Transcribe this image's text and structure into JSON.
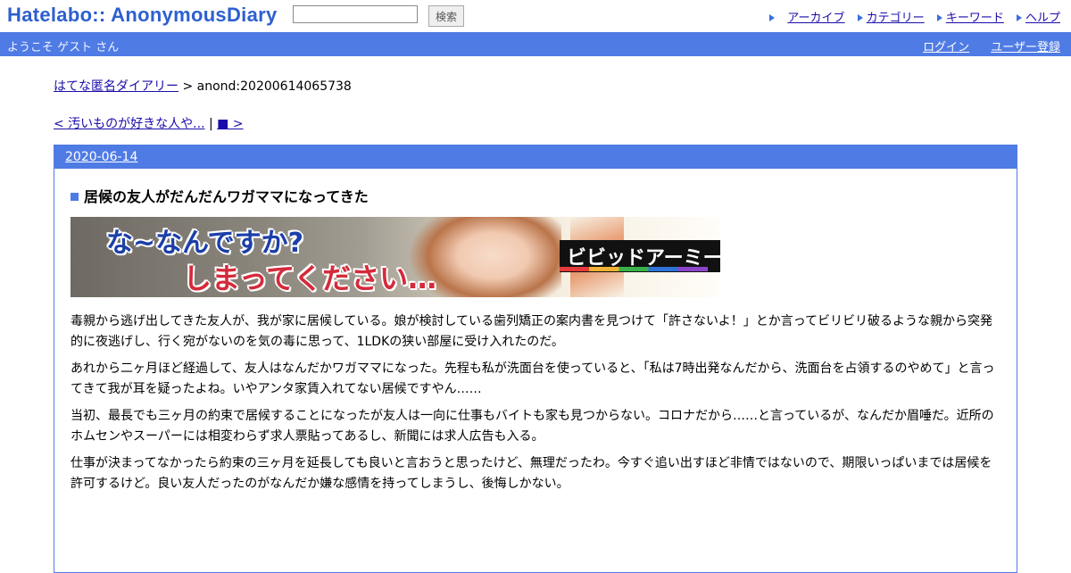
{
  "header": {
    "logo": "Hatelabo:: AnonymousDiary",
    "search_placeholder": "",
    "search_button": "検索",
    "links": [
      "アーカイブ",
      "カテゴリー",
      "キーワード",
      "ヘルプ"
    ]
  },
  "bar": {
    "welcome": "ようこそ ゲスト さん",
    "login": "ログイン",
    "register": "ユーザー登録"
  },
  "breadcrumb": {
    "home": "はてな匿名ダイアリー",
    "separator": " > ",
    "current": "anond:20200614065738"
  },
  "pager": {
    "prev": "< 汚いものが好きな人や...",
    "separator": " | ",
    "next": "■ >"
  },
  "entry": {
    "date": "2020-06-14",
    "title": "居候の友人がだんだんワガママになってきた",
    "banner": {
      "line1": "な~なんですか?",
      "line2": "しまってください…",
      "logo": "ビビッドアーミー"
    },
    "paragraphs": [
      "毒親から逃げ出してきた友人が、我が家に居候している。娘が検討している歯列矯正の案内書を見つけて「許さないよ！」とか言ってビリビリ破るような親から突発的に夜逃げし、行く宛がないのを気の毒に思って、1LDKの狭い部屋に受け入れたのだ。",
      "あれから二ヶ月ほど経過して、友人はなんだかワガママになった。先程も私が洗面台を使っていると、「私は7時出発なんだから、洗面台を占領するのやめて」と言ってきて我が耳を疑ったよね。いやアンタ家賃入れてない居候ですやん……",
      "当初、最長でも三ヶ月の約束で居候することになったが友人は一向に仕事もバイトも家も見つからない。コロナだから……と言っているが、なんだか眉唾だ。近所のホムセンやスーパーには相変わらず求人票貼ってあるし、新聞には求人広告も入る。",
      "仕事が決まってなかったら約束の三ヶ月を延長しても良いと言おうと思ったけど、無理だったわ。今すぐ追い出すほど非情ではないので、期限いっぱいまでは居候を許可するけど。良い友人だったのがなんだか嫌な感情を持ってしまうし、後悔しかない。"
    ]
  },
  "colors": {
    "accent": "#4f7be5",
    "logo": "#2d5fd0",
    "link": "#1a0dab"
  }
}
